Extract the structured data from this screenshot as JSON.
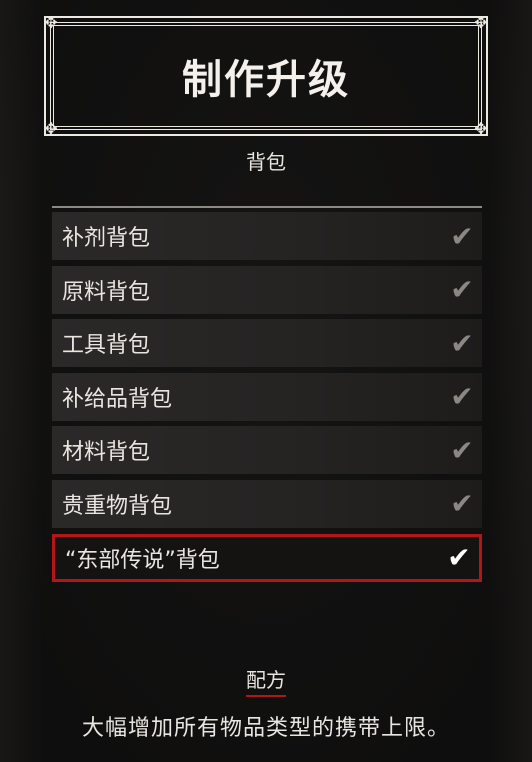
{
  "title": "制作升级",
  "section_label": "背包",
  "items": [
    {
      "label": "补剂背包",
      "checked": true,
      "selected": false
    },
    {
      "label": "原料背包",
      "checked": true,
      "selected": false
    },
    {
      "label": "工具背包",
      "checked": true,
      "selected": false
    },
    {
      "label": "补给品背包",
      "checked": true,
      "selected": false
    },
    {
      "label": "材料背包",
      "checked": true,
      "selected": false
    },
    {
      "label": "贵重物背包",
      "checked": true,
      "selected": false
    },
    {
      "label": "“东部传说”背包",
      "checked": true,
      "selected": true
    }
  ],
  "recipe_label": "配方",
  "description": "大幅增加所有物品类型的携带上限。",
  "colors": {
    "selection_border": "#b3161a",
    "text": "#e9e6e1"
  },
  "icons": {
    "check": "checkmark-icon",
    "ornament": "ornament-icon"
  }
}
